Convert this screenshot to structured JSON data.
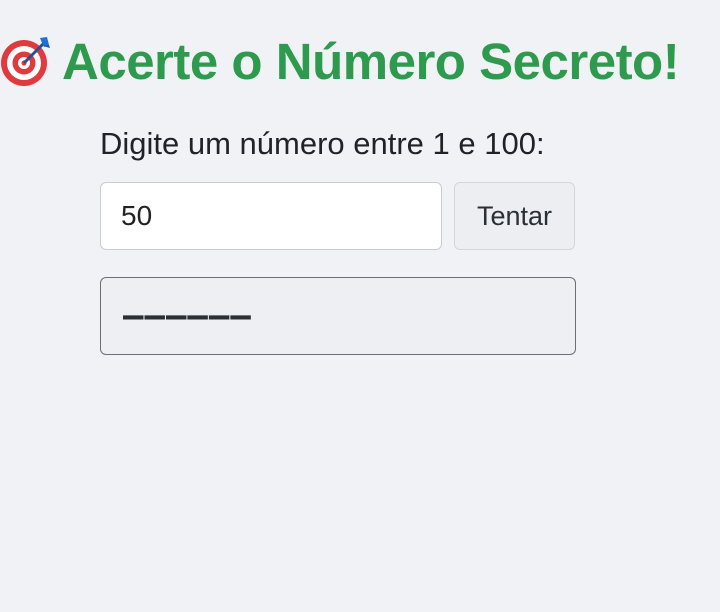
{
  "header": {
    "icon": "target-dart-icon",
    "title": "Acerte o Número Secreto!",
    "title_color": "#2e9a4e"
  },
  "game": {
    "prompt": "Digite um número entre 1 e 100:",
    "input_value": "50",
    "try_button_label": "Tentar",
    "result_text": "––––––"
  }
}
